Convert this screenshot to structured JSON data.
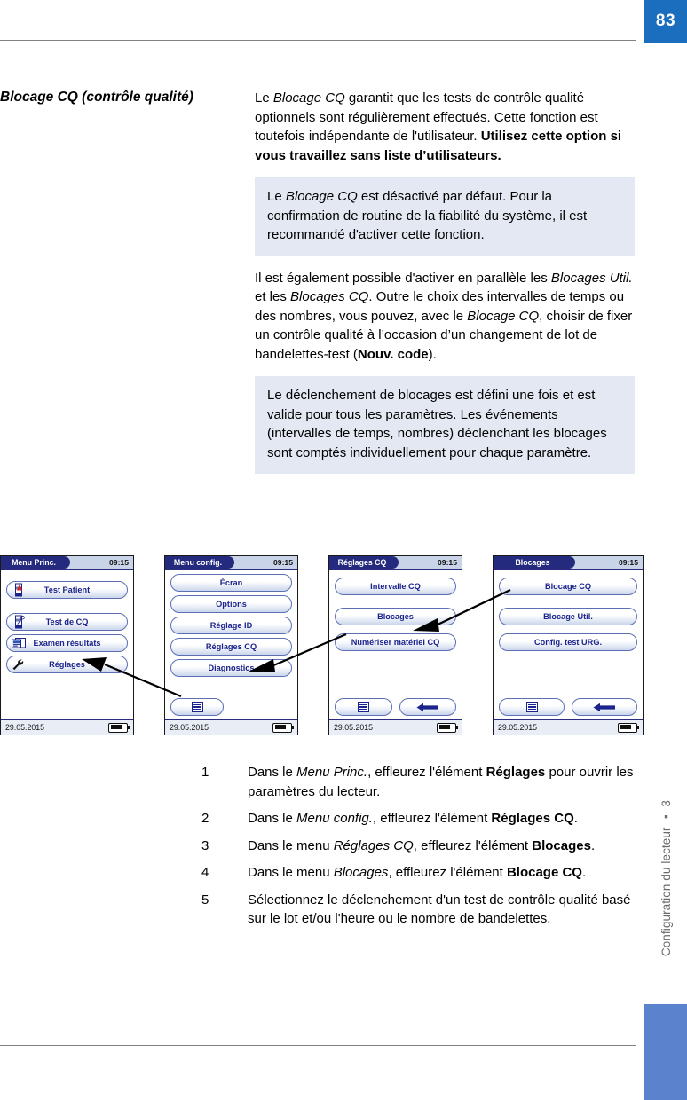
{
  "page": {
    "number": "83",
    "running_head": "Configuration du lecteur ▪ 3"
  },
  "section": {
    "heading": "Blocage CQ (contrôle qualité)"
  },
  "body": {
    "paragraph_1": {
      "part_1": "Le ",
      "italic_1": "Blocage CQ",
      "part_2": " garantit que les tests de contrôle qualité optionnels sont régulièrement effectués. Cette fonction est toutefois indépendante de l'utilisateur. ",
      "bold_1": "Utilisez cette option si vous travaillez sans liste d’utilisateurs."
    },
    "note_1": {
      "part_1": "Le ",
      "italic_1": "Blocage CQ",
      "part_2": " est désactivé par défaut. Pour la confirmation de routine de la fiabilité du système, il est recommandé d'activer cette fonction."
    },
    "paragraph_2": {
      "part_1": "Il est également possible d'activer en parallèle les ",
      "italic_1": "Blocages Util.",
      "part_2": " et les ",
      "italic_2": "Blocages CQ",
      "part_3": ". Outre le choix des intervalles de temps ou des nombres, vous pouvez, avec le ",
      "italic_3": "Blocage CQ",
      "part_4": ", choisir de fixer un contrôle qualité à l’occasion d’un changement de lot de bandelettes-test (",
      "bold_1": "Nouv. code",
      "part_5": ")."
    },
    "note_2": {
      "text": "Le déclenchement de blocages est défini une fois et est valide pour tous les paramètres. Les événements (intervalles de temps, nombres) déclenchant les blocages sont comptés individuellement pour chaque paramètre."
    }
  },
  "devices": [
    {
      "title": "Menu Princ.",
      "time": "09:15",
      "date": "29.05.2015",
      "buttons": [
        {
          "label": "Test Patient",
          "icon": "test-strip-blood-drop-icon"
        },
        {
          "label": "Test de CQ",
          "icon": "test-strip-pipette-icon"
        },
        {
          "label": "Examen résultats",
          "icon": "results-review-icon"
        },
        {
          "label": "Réglages",
          "icon": "wrench-icon"
        }
      ],
      "bottom_buttons": []
    },
    {
      "title": "Menu config.",
      "time": "09:15",
      "date": "29.05.2015",
      "buttons": [
        {
          "label": "Écran",
          "icon": ""
        },
        {
          "label": "Options",
          "icon": ""
        },
        {
          "label": "Réglage ID",
          "icon": ""
        },
        {
          "label": "Réglages CQ",
          "icon": ""
        },
        {
          "label": "Diagnostics",
          "icon": ""
        }
      ],
      "bottom_buttons": [
        {
          "label": "",
          "icon": "list-menu-icon"
        }
      ]
    },
    {
      "title": "Réglages CQ",
      "time": "09:15",
      "date": "29.05.2015",
      "buttons": [
        {
          "label": "Intervalle CQ",
          "icon": ""
        },
        {
          "label": "Blocages",
          "icon": ""
        },
        {
          "label": "Numériser matériel CQ",
          "icon": ""
        }
      ],
      "bottom_buttons": [
        {
          "label": "",
          "icon": "list-menu-icon"
        },
        {
          "label": "",
          "icon": "arrow-left-icon"
        }
      ]
    },
    {
      "title": "Blocages",
      "time": "09:15",
      "date": "29.05.2015",
      "buttons": [
        {
          "label": "Blocage CQ",
          "icon": ""
        },
        {
          "label": "Blocage Util.",
          "icon": ""
        },
        {
          "label": "Config. test URG.",
          "icon": ""
        }
      ],
      "bottom_buttons": [
        {
          "label": "",
          "icon": "list-menu-icon"
        },
        {
          "label": "",
          "icon": "arrow-left-icon"
        }
      ]
    }
  ],
  "steps": [
    {
      "num": "1",
      "part_1": "Dans le ",
      "italic_1": "Menu Princ.",
      "part_2": ", effleurez l'élément ",
      "bold_1": "Réglages",
      "part_3": " pour ouvrir les paramètres du lecteur."
    },
    {
      "num": "2",
      "part_1": "Dans le ",
      "italic_1": "Menu config.",
      "part_2": ", effleurez l'élément ",
      "bold_1": "Réglages CQ",
      "part_3": "."
    },
    {
      "num": "3",
      "part_1": "Dans le menu ",
      "italic_1": "Réglages CQ",
      "part_2": ", effleurez l'élément ",
      "bold_1": "Blocages",
      "part_3": "."
    },
    {
      "num": "4",
      "part_1": "Dans le menu ",
      "italic_1": "Blocages",
      "part_2": ", effleurez l'élément ",
      "bold_1": "Blocage CQ",
      "part_3": "."
    },
    {
      "num": "5",
      "part_1": "Sélectionnez le déclenchement d'un test de contrôle qualité basé sur le lot et/ou l'heure ou le nombre de bandelettes.",
      "italic_1": "",
      "part_2": "",
      "bold_1": "",
      "part_3": ""
    }
  ],
  "colors": {
    "page_badge": "#1b6dbd",
    "side_tab": "#5b82cd",
    "note_bg": "#e3e8f3",
    "device_title_bg": "#242a7d",
    "device_text": "#1b238c"
  }
}
